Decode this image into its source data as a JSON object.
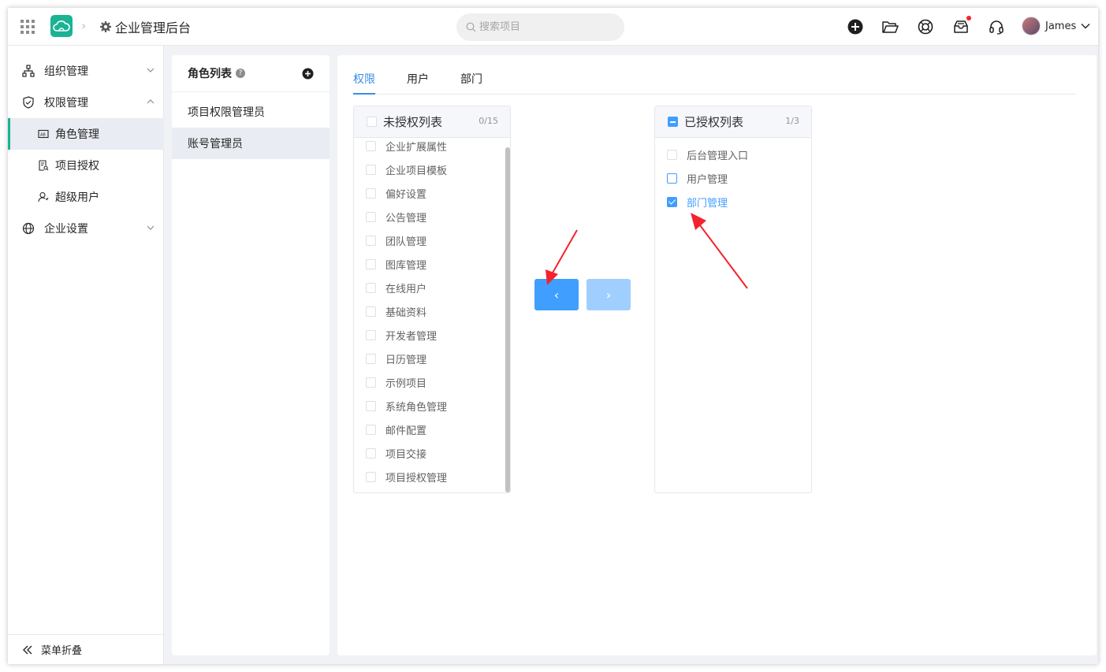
{
  "header": {
    "app_title": "企业管理后台",
    "search_placeholder": "搜索项目",
    "user_name": "James"
  },
  "sidebar": {
    "items": [
      {
        "label": "组织管理",
        "icon": "org-chart-icon"
      },
      {
        "label": "权限管理",
        "icon": "shield-icon"
      },
      {
        "label": "角色管理",
        "icon": "id-card-icon"
      },
      {
        "label": "项目授权",
        "icon": "document-key-icon"
      },
      {
        "label": "超级用户",
        "icon": "user-icon"
      },
      {
        "label": "企业设置",
        "icon": "globe-icon"
      }
    ],
    "footer_label": "菜单折叠"
  },
  "roles": {
    "title": "角色列表",
    "items": [
      "项目权限管理员",
      "账号管理员"
    ],
    "selected": "账号管理员"
  },
  "tabs": [
    "权限",
    "用户",
    "部门"
  ],
  "active_tab": "权限",
  "transfer": {
    "left": {
      "title": "未授权列表",
      "count": "0/15",
      "items": [
        "企业扩展属性",
        "企业项目模板",
        "偏好设置",
        "公告管理",
        "团队管理",
        "图库管理",
        "在线用户",
        "基础资料",
        "开发者管理",
        "日历管理",
        "示例项目",
        "系统角色管理",
        "邮件配置",
        "项目交接",
        "项目授权管理"
      ]
    },
    "right": {
      "title": "已授权列表",
      "count": "1/3",
      "items": [
        "后台管理入口",
        "用户管理",
        "部门管理"
      ],
      "checked": [
        "部门管理"
      ]
    },
    "to_left_button": "‹",
    "to_right_button": "›"
  },
  "colors": {
    "accent": "#409eff",
    "brand": "#1ab394",
    "annotation_arrow": "#f5222d"
  }
}
